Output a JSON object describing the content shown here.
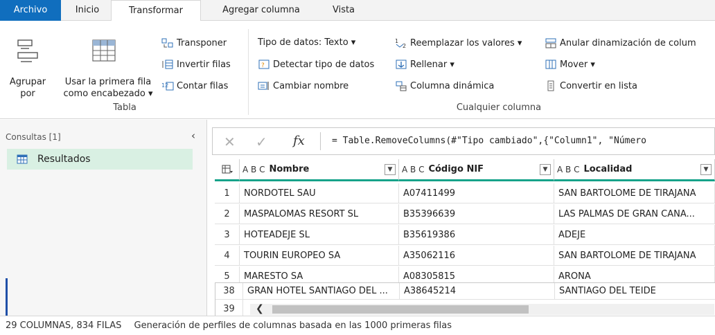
{
  "tabs": {
    "archivo": "Archivo",
    "inicio": "Inicio",
    "transformar": "Transformar",
    "agregar": "Agregar columna",
    "vista": "Vista"
  },
  "ribbon": {
    "agrupar": "Agrupar\npor",
    "usar_primera_fila": "Usar la primera fila\ncomo encabezado ▾",
    "transponer": "Transponer",
    "invertir_filas": "Invertir filas",
    "contar_filas": "Contar filas",
    "group_tabla": "Tabla",
    "tipo_datos": "Tipo de datos: Texto ▾",
    "detectar_tipo": "Detectar tipo de datos",
    "cambiar_nombre": "Cambiar nombre",
    "reemplazar_valores": "Reemplazar los valores ▾",
    "rellenar": "Rellenar ▾",
    "columna_dinamica": "Columna dinámica",
    "anular_dinamizacion": "Anular dinamización de colum",
    "mover": "Mover ▾",
    "convertir_lista": "Convertir en lista",
    "group_cualquier": "Cualquier columna"
  },
  "left_pane": {
    "title": "Consultas [1]",
    "query": "Resultados"
  },
  "formula": {
    "fx": "fx",
    "text": "= Table.RemoveColumns(#\"Tipo cambiado\",{\"Column1\", \"Número"
  },
  "grid": {
    "type_label": "A B C",
    "columns": [
      "Nombre",
      "Código NIF",
      "Localidad"
    ],
    "rows": [
      {
        "n": "1",
        "c": [
          "NORDOTEL SAU",
          "A07411499",
          "SAN BARTOLOME DE TIRAJANA"
        ]
      },
      {
        "n": "2",
        "c": [
          "MASPALOMAS RESORT SL",
          "B35396639",
          "LAS PALMAS DE GRAN CANA..."
        ]
      },
      {
        "n": "3",
        "c": [
          "HOTEADEJE SL",
          "B35619386",
          "ADEJE"
        ]
      },
      {
        "n": "4",
        "c": [
          "TOURIN EUROPEO SA",
          "A35062116",
          "SAN BARTOLOME DE TIRAJANA"
        ]
      },
      {
        "n": "5",
        "c": [
          "MARESTO SA",
          "A08305815",
          "ARONA"
        ]
      }
    ],
    "overlay_rows": [
      {
        "n": "38",
        "c": [
          "GRAN HOTEL SANTIAGO DEL ...",
          "A38645214",
          "SANTIAGO DEL TEIDE"
        ]
      },
      {
        "n": "39",
        "c": [
          "",
          "",
          ""
        ]
      }
    ]
  },
  "status": {
    "counts": "29 COLUMNAS, 834 FILAS",
    "profile": "Generación de perfiles de columnas basada en las 1000 primeras filas"
  },
  "colors": {
    "accent": "#106ebe",
    "header_underline": "#16a38a",
    "selected_query": "#d9f0e3"
  }
}
